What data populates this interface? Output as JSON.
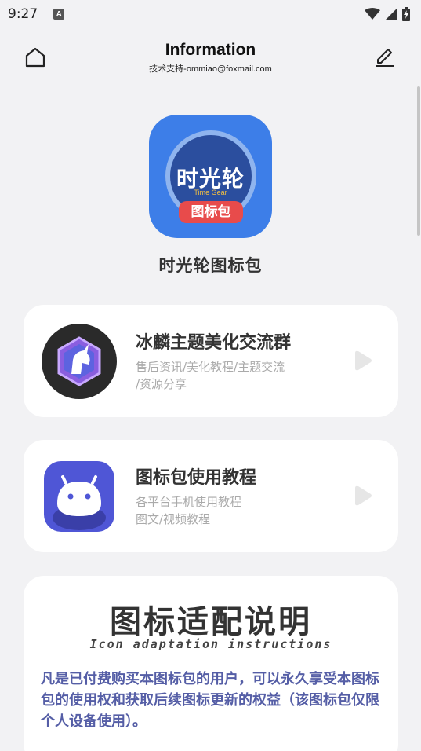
{
  "status_bar": {
    "time": "9:27",
    "notification_icon": "A",
    "icons": [
      "wifi-icon",
      "signal-icon",
      "battery-icon"
    ]
  },
  "header": {
    "title": "Information",
    "subtitle": "技术支持-ommiao@foxmail.com",
    "left_icon": "home-icon",
    "right_icon": "edit-icon"
  },
  "app": {
    "icon_text": "时光轮",
    "icon_subtext": "Time Gear",
    "icon_badge": "图标包",
    "name": "时光轮图标包",
    "accent": "#3d7ee8"
  },
  "cards": [
    {
      "title": "冰麟主题美化交流群",
      "desc_line1": "售后资讯/美化教程/主题交流",
      "desc_line2": "/资源分享",
      "icon": "unicorn-icon"
    },
    {
      "title": "图标包使用教程",
      "desc_line1": "各平台手机使用教程",
      "desc_line2": "图文/视频教程",
      "icon": "android-icon"
    }
  ],
  "notice": {
    "title": "图标适配说明",
    "subtitle": "Icon adaptation instructions",
    "body": "凡是已付费购买本图标包的用户，可以永久享受本图标包的使用权和获取后续图标更新的权益（该图标包仅限个人设备使用）。",
    "body_color": "#555ea6"
  }
}
